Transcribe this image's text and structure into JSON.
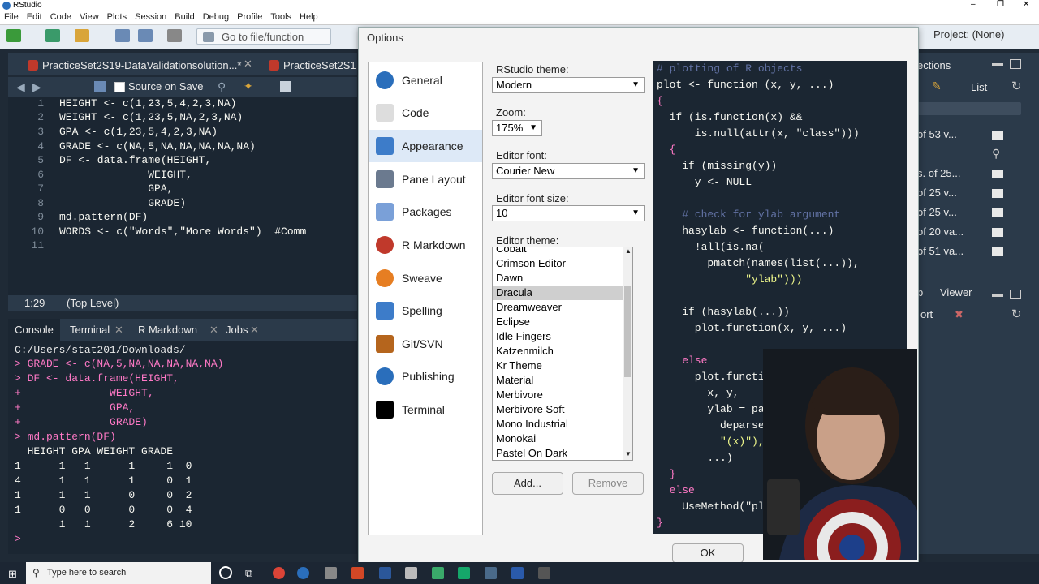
{
  "app": {
    "title": "RStudio",
    "window_controls": [
      "–",
      "❐",
      "✕"
    ]
  },
  "menu": [
    "File",
    "Edit",
    "Code",
    "View",
    "Plots",
    "Session",
    "Build",
    "Debug",
    "Profile",
    "Tools",
    "Help"
  ],
  "toolbar": {
    "goto_placeholder": "Go to file/function",
    "project_label": "Project: (None)"
  },
  "editor": {
    "tabs": [
      "PracticeSet2S19-DataValidationsolution...*",
      "PracticeSet2S1"
    ],
    "source_on_save": "Source on Save",
    "lines": [
      {
        "n": "1",
        "code": "HEIGHT <- c(1,23,5,4,2,3,NA)"
      },
      {
        "n": "2",
        "code": "WEIGHT <- c(1,23,5,NA,2,3,NA)"
      },
      {
        "n": "3",
        "code": "GPA <- c(1,23,5,4,2,3,NA)"
      },
      {
        "n": "4",
        "code": "GRADE <- c(NA,5,NA,NA,NA,NA,NA)"
      },
      {
        "n": "5",
        "code": "DF <- data.frame(HEIGHT,"
      },
      {
        "n": "6",
        "code": "              WEIGHT,"
      },
      {
        "n": "7",
        "code": "              GPA,"
      },
      {
        "n": "8",
        "code": "              GRADE)"
      },
      {
        "n": "9",
        "code": "md.pattern(DF)"
      },
      {
        "n": "10",
        "code": "WORDS <- c(\"Words\",\"More Words\")  #Comm"
      },
      {
        "n": "11",
        "code": ""
      }
    ],
    "status_pos": "1:29",
    "status_scope": "(Top Level)"
  },
  "console": {
    "tabs": [
      "Console",
      "Terminal",
      "R Markdown",
      "Jobs"
    ],
    "path": "C:/Users/stat201/Downloads/",
    "lines": [
      "> GRADE <- c(NA,5,NA,NA,NA,NA,NA)",
      "> DF <- data.frame(HEIGHT,",
      "+              WEIGHT,",
      "+              GPA,",
      "+              GRADE)",
      "> md.pattern(DF)",
      "  HEIGHT GPA WEIGHT GRADE",
      "1      1   1      1     1  0",
      "4      1   1      1     0  1",
      "1      1   1      0     0  2",
      "1      0   0      0     0  4",
      "       1   1      2     6 10",
      ">"
    ]
  },
  "right_pane": {
    "tab_label": "ections",
    "list_label": "List",
    "env_rows": [
      "of 53 v...",
      "s. of 25...",
      "of 25 v...",
      "of 25 v...",
      "of 20 va...",
      "of 51 va..."
    ],
    "lower_tabs": [
      "p",
      "Viewer"
    ],
    "export_label": "ort"
  },
  "dialog": {
    "title": "Options",
    "categories": [
      {
        "label": "General",
        "icon": "r-logo-icon",
        "color": "#2a6ebb"
      },
      {
        "label": "Code",
        "icon": "code-icon",
        "color": "#dddddd"
      },
      {
        "label": "Appearance",
        "icon": "appearance-icon",
        "color": "#3d7cc9"
      },
      {
        "label": "Pane Layout",
        "icon": "pane-layout-icon",
        "color": "#6b7a8f"
      },
      {
        "label": "Packages",
        "icon": "packages-icon",
        "color": "#7aa0d8"
      },
      {
        "label": "R Markdown",
        "icon": "rmarkdown-icon",
        "color": "#c0392b"
      },
      {
        "label": "Sweave",
        "icon": "sweave-icon",
        "color": "#e67e22"
      },
      {
        "label": "Spelling",
        "icon": "spelling-icon",
        "color": "#3d7cc9"
      },
      {
        "label": "Git/SVN",
        "icon": "git-svn-icon",
        "color": "#b5651d"
      },
      {
        "label": "Publishing",
        "icon": "publishing-icon",
        "color": "#2a6ebb"
      },
      {
        "label": "Terminal",
        "icon": "terminal-icon",
        "color": "#000000"
      }
    ],
    "selected_category": "Appearance",
    "rstudio_theme_label": "RStudio theme:",
    "rstudio_theme_value": "Modern",
    "zoom_label": "Zoom:",
    "zoom_value": "175%",
    "editor_font_label": "Editor font:",
    "editor_font_value": "Courier New",
    "editor_font_size_label": "Editor font size:",
    "editor_font_size_value": "10",
    "editor_theme_label": "Editor theme:",
    "themes": [
      "Cobalt",
      "Crimson Editor",
      "Dawn",
      "Dracula",
      "Dreamweaver",
      "Eclipse",
      "Idle Fingers",
      "Katzenmilch",
      "Kr Theme",
      "Material",
      "Merbivore",
      "Merbivore Soft",
      "Mono Industrial",
      "Monokai",
      "Pastel On Dark"
    ],
    "selected_theme": "Dracula",
    "add_button": "Add...",
    "remove_button": "Remove",
    "ok_button": "OK",
    "preview_lines": [
      "# plotting of R objects",
      "plot <- function (x, y, ...)",
      "{",
      "  if (is.function(x) &&",
      "      is.null(attr(x, \"class\")))",
      "  {",
      "    if (missing(y))",
      "      y <- NULL",
      "",
      "    # check for ylab argument",
      "    hasylab <- function(...)",
      "      !all(is.na(",
      "        pmatch(names(list(...)),",
      "              \"ylab\")))",
      "",
      "    if (hasylab(...))",
      "      plot.function(x, y, ...)",
      "",
      "    else",
      "      plot.function(",
      "        x, y,",
      "        ylab = paste(",
      "          deparse(subs",
      "          \"(x)\"),",
      "        ...)",
      "  }",
      "  else",
      "    UseMethod(\"plo",
      "}"
    ]
  },
  "taskbar": {
    "search_placeholder": "Type here to search"
  },
  "colors": {
    "dracula_bg": "#1b2632",
    "pane_header": "#2b3a4a",
    "dialog_bg": "#f3f3f3",
    "selected_category_bg": "#dde9f7"
  }
}
